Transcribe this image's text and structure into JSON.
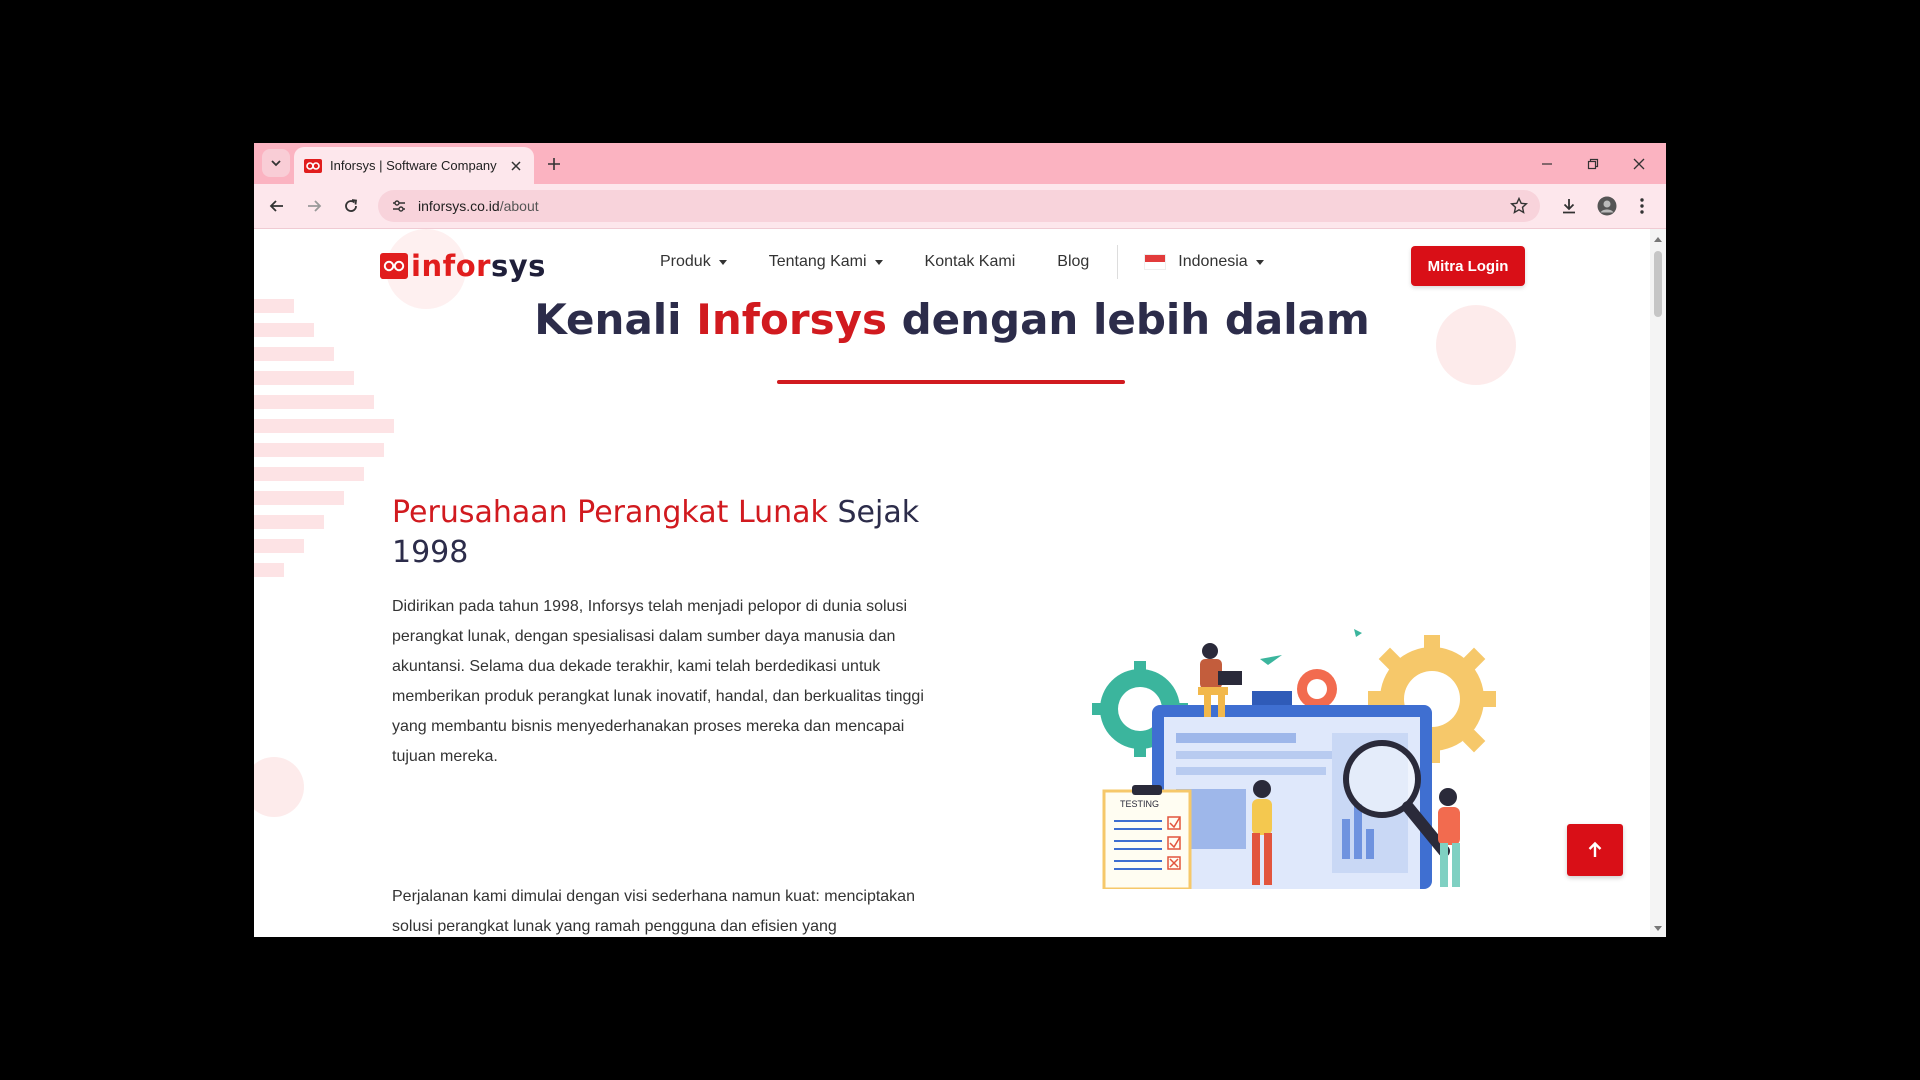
{
  "browser": {
    "tab_title": "Inforsys | Software Company",
    "url_host": "inforsys.co.id",
    "url_path": "/about"
  },
  "site": {
    "logo_text_a": "infor",
    "logo_text_b": "sys",
    "nav": [
      {
        "label": "Produk"
      },
      {
        "label": "Tentang Kami"
      },
      {
        "label": "Kontak Kami"
      },
      {
        "label": "Blog"
      },
      {
        "label": "Indonesia"
      }
    ],
    "login_label": "Mitra Login"
  },
  "hero": {
    "title_pre": "Kenali",
    "title_highlight": "Inforsys",
    "title_post": "dengan lebih dalam"
  },
  "about": {
    "heading_highlight": "Perusahaan Perangkat Lunak",
    "heading_rest": "Sejak 1998",
    "paragraph1": "Didirikan pada tahun 1998, Inforsys telah menjadi pelopor di dunia solusi perangkat lunak, dengan spesialisasi dalam sumber daya manusia dan akuntansi. Selama dua dekade terakhir, kami telah berdedikasi untuk memberikan produk perangkat lunak inovatif, handal, dan berkualitas tinggi yang membantu bisnis menyederhanakan proses mereka dan mencapai tujuan mereka.",
    "paragraph2": "Perjalanan kami dimulai dengan visi sederhana namun kuat: menciptakan solusi perangkat lunak yang ramah pengguna dan efisien yang memberdayakan bisnis untuk mengoptimalkan potensi",
    "illustration_label": "TESTING"
  },
  "colors": {
    "brand_red": "#d90f17",
    "title_navy": "#2c2c4a",
    "tabbar_pink": "#fbb3c1"
  }
}
